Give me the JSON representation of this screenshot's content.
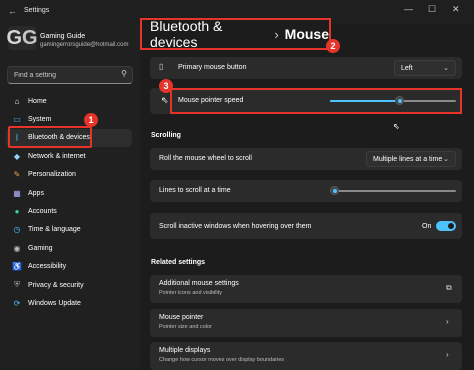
{
  "window": {
    "title": "Settings",
    "back_glyph": "←",
    "minimize_glyph": "—",
    "maximize_glyph": "☐",
    "close_glyph": "✕"
  },
  "account": {
    "initials_1": "G",
    "initials_2": "G",
    "name": "Gaming Guide",
    "email": "gamingerrorsguide@hotmail.com"
  },
  "search": {
    "placeholder": "Find a setting",
    "icon": "search-icon"
  },
  "nav": [
    {
      "label": "Home",
      "icon": "home-icon",
      "glyph": "⌂",
      "color": "#e8e8e8"
    },
    {
      "label": "System",
      "icon": "monitor-icon",
      "glyph": "▭",
      "color": "#4cc2ff"
    },
    {
      "label": "Bluetooth & devices",
      "icon": "bluetooth-icon",
      "glyph": "ᛒ",
      "color": "#4cc2ff"
    },
    {
      "label": "Network & internet",
      "icon": "network-icon",
      "glyph": "◆",
      "color": "#8fd3ff"
    },
    {
      "label": "Personalization",
      "icon": "brush-icon",
      "glyph": "✎",
      "color": "#f0a04b"
    },
    {
      "label": "Apps",
      "icon": "apps-icon",
      "glyph": "▦",
      "color": "#b0b0ff"
    },
    {
      "label": "Accounts",
      "icon": "person-icon",
      "glyph": "●",
      "color": "#3ad19b"
    },
    {
      "label": "Time & language",
      "icon": "globe-icon",
      "glyph": "◷",
      "color": "#4cc2ff"
    },
    {
      "label": "Gaming",
      "icon": "controller-icon",
      "glyph": "◉",
      "color": "#bdbdbd"
    },
    {
      "label": "Accessibility",
      "icon": "accessibility-icon",
      "glyph": "♿",
      "color": "#4cc2ff"
    },
    {
      "label": "Privacy & security",
      "icon": "shield-icon",
      "glyph": "⛨",
      "color": "#a0a0a0"
    },
    {
      "label": "Windows Update",
      "icon": "update-icon",
      "glyph": "⟳",
      "color": "#4cc2ff"
    }
  ],
  "active_nav_index": 2,
  "breadcrumb": {
    "parent": "Bluetooth & devices",
    "separator": "›",
    "current": "Mouse"
  },
  "annotations": {
    "badge_1": "1",
    "badge_2": "2",
    "badge_3": "3",
    "color": "#e5352b"
  },
  "settings": {
    "primary_button": {
      "label": "Primary mouse button",
      "value": "Left",
      "icon": "mouse-icon"
    },
    "pointer_speed": {
      "label": "Mouse pointer speed",
      "level": 0.55,
      "icon": "pointer-icon"
    },
    "scrolling_header": "Scrolling",
    "roll_wheel": {
      "label": "Roll the mouse wheel to scroll",
      "value": "Multiple lines at a time"
    },
    "lines_to_scroll": {
      "label": "Lines to scroll at a time",
      "level": 0.03
    },
    "scroll_inactive": {
      "label": "Scroll inactive windows when hovering over them",
      "state": "On",
      "on": true
    }
  },
  "related": {
    "header": "Related settings",
    "items": [
      {
        "title": "Additional mouse settings",
        "subtitle": "Pointer icons and visibility",
        "icon": "external-link-icon",
        "glyph": "⧉"
      },
      {
        "title": "Mouse pointer",
        "subtitle": "Pointer size and color",
        "icon": "chevron-right-icon",
        "glyph": "›"
      },
      {
        "title": "Multiple displays",
        "subtitle": "Change how cursor moves over display boundaries",
        "icon": "chevron-right-icon",
        "glyph": "›"
      }
    ]
  },
  "colors": {
    "accent": "#4cc2ff",
    "background": "#1c1c1c",
    "card": "#2b2b2b"
  }
}
